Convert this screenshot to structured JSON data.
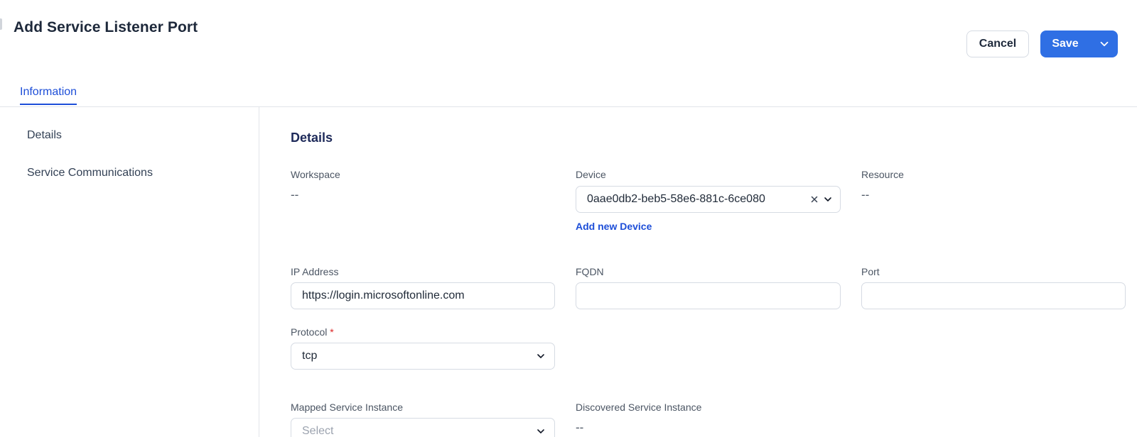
{
  "header": {
    "title": "Add Service Listener Port",
    "cancel_label": "Cancel",
    "save_label": "Save"
  },
  "tabs": [
    {
      "label": "Information",
      "active": true
    }
  ],
  "sidebar": {
    "items": [
      {
        "label": "Details"
      },
      {
        "label": "Service Communications"
      }
    ]
  },
  "form": {
    "section_title": "Details",
    "workspace": {
      "label": "Workspace",
      "value": "--"
    },
    "device": {
      "label": "Device",
      "value": "0aae0db2-beb5-58e6-881c-6ce080",
      "add_link": "Add new Device"
    },
    "resource": {
      "label": "Resource",
      "value": "--"
    },
    "ip_address": {
      "label": "IP Address",
      "value": "https://login.microsoftonline.com"
    },
    "fqdn": {
      "label": "FQDN",
      "value": ""
    },
    "port": {
      "label": "Port",
      "value": ""
    },
    "protocol": {
      "label": "Protocol",
      "required_mark": "*",
      "value": "tcp"
    },
    "mapped_service_instance": {
      "label": "Mapped Service Instance",
      "placeholder": "Select"
    },
    "discovered_service_instance": {
      "label": "Discovered Service Instance",
      "value": "--"
    }
  },
  "colors": {
    "accent": "#2f6fe4",
    "link": "#1d4ed8",
    "required": "#dc2626"
  }
}
